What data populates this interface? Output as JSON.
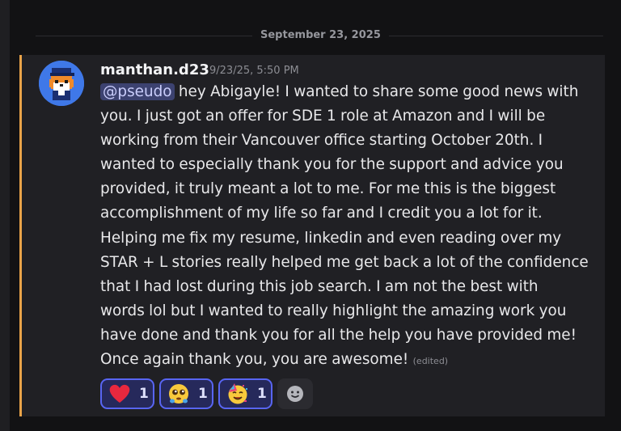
{
  "divider": {
    "date": "September 23, 2025"
  },
  "message": {
    "username": "manthan.d23",
    "timestamp": "9/23/25, 5:50 PM",
    "mention": "@pseudo",
    "lines": [
      " hey Abigayle! I wanted to share some good news with",
      "you. I just got an offer for SDE 1 role at Amazon and I will be",
      "working from their Vancouver office starting October 20th. I",
      "wanted to especially thank you for the support and advice you",
      "provided, it truly meant a lot to me. For me this is the biggest",
      "accomplishment of my life so far and I credit you a lot for it.",
      "Helping me fix my resume, linkedin and even reading over my",
      "STAR + L stories really helped me get back a lot of the confidence",
      "that I had lost during this job search. I am not the best with",
      "words lol but I wanted to really highlight the amazing work you",
      "have done and thank you for all the help you have provided me!",
      "Once again thank you, you are awesome! "
    ],
    "edited_label": "(edited)"
  },
  "reactions": [
    {
      "emoji": "heart-icon",
      "count": "1"
    },
    {
      "emoji": "pleading-face-icon",
      "count": "1"
    },
    {
      "emoji": "partying-face-icon",
      "count": "1"
    }
  ],
  "colors": {
    "background": "#121214",
    "message_bg": "#202024",
    "highlight_bar": "#e9a349",
    "mention_bg": "#3c4270",
    "reaction_border": "#5865f2"
  }
}
